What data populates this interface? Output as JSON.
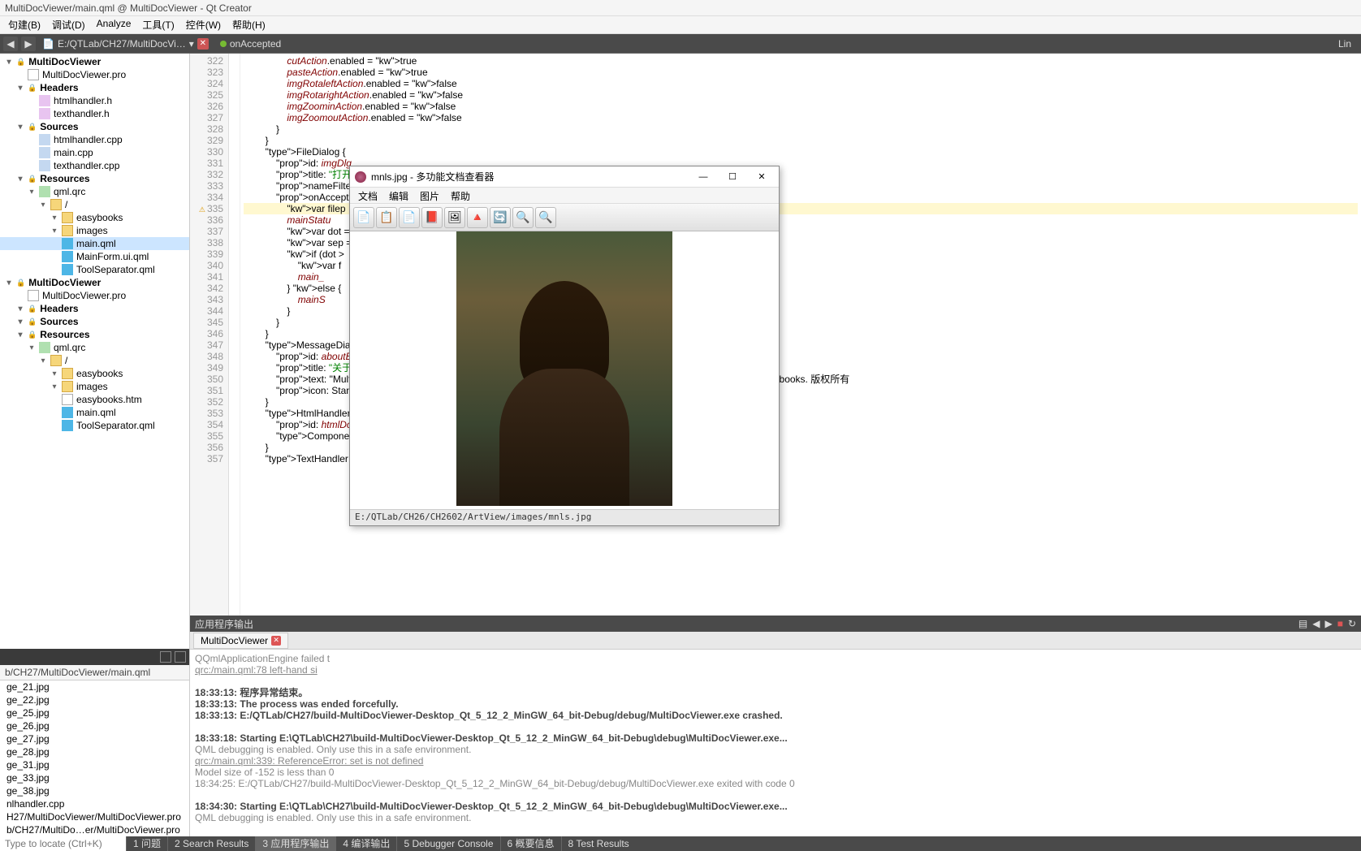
{
  "window": {
    "title": "MultiDocViewer/main.qml @ MultiDocViewer - Qt Creator"
  },
  "menu": {
    "items": [
      "句建(B)",
      "调试(D)",
      "Analyze",
      "工具(T)",
      "控件(W)",
      "帮助(H)"
    ]
  },
  "toolbar": {
    "path": "E:/QTLab/CH27/MultiDocVi…",
    "crumb": "onAccepted",
    "right": "Lin"
  },
  "project_tree": {
    "root": "MultiDocViewer",
    "items": [
      {
        "l": 0,
        "t": "hdr",
        "label": "MultiDocViewer"
      },
      {
        "l": 1,
        "t": "proj",
        "label": "MultiDocViewer.pro"
      },
      {
        "l": 1,
        "t": "hdr",
        "label": "Headers"
      },
      {
        "l": 2,
        "t": "h",
        "label": "htmlhandler.h"
      },
      {
        "l": 2,
        "t": "h",
        "label": "texthandler.h"
      },
      {
        "l": 1,
        "t": "hdr",
        "label": "Sources"
      },
      {
        "l": 2,
        "t": "cpp",
        "label": "htmlhandler.cpp"
      },
      {
        "l": 2,
        "t": "cpp",
        "label": "main.cpp"
      },
      {
        "l": 2,
        "t": "cpp",
        "label": "texthandler.cpp"
      },
      {
        "l": 1,
        "t": "hdr",
        "label": "Resources"
      },
      {
        "l": 2,
        "t": "qrc",
        "label": "qml.qrc"
      },
      {
        "l": 3,
        "t": "fold",
        "label": "/"
      },
      {
        "l": 4,
        "t": "fold",
        "label": "easybooks"
      },
      {
        "l": 4,
        "t": "fold",
        "label": "images"
      },
      {
        "l": 4,
        "t": "qml",
        "label": "main.qml",
        "sel": true
      },
      {
        "l": 4,
        "t": "qml",
        "label": "MainForm.ui.qml"
      },
      {
        "l": 4,
        "t": "qml",
        "label": "ToolSeparator.qml"
      },
      {
        "l": 0,
        "t": "hdr",
        "label": "MultiDocViewer"
      },
      {
        "l": 1,
        "t": "proj",
        "label": "MultiDocViewer.pro"
      },
      {
        "l": 1,
        "t": "hdr",
        "label": "Headers"
      },
      {
        "l": 1,
        "t": "hdr",
        "label": "Sources"
      },
      {
        "l": 1,
        "t": "hdr",
        "label": "Resources"
      },
      {
        "l": 2,
        "t": "qrc",
        "label": "qml.qrc"
      },
      {
        "l": 3,
        "t": "fold",
        "label": "/"
      },
      {
        "l": 4,
        "t": "fold",
        "label": "easybooks"
      },
      {
        "l": 4,
        "t": "fold",
        "label": "images"
      },
      {
        "l": 4,
        "t": "file",
        "label": "easybooks.htm"
      },
      {
        "l": 4,
        "t": "qml",
        "label": "main.qml"
      },
      {
        "l": 4,
        "t": "qml",
        "label": "ToolSeparator.qml"
      }
    ]
  },
  "open_doc": {
    "current": "b/CH27/MultiDocViewer/main.qml",
    "list": [
      "ge_21.jpg",
      "ge_22.jpg",
      "ge_25.jpg",
      "ge_26.jpg",
      "ge_27.jpg",
      "ge_28.jpg",
      "ge_31.jpg",
      "ge_33.jpg",
      "ge_38.jpg",
      "nlhandler.cpp",
      "H27/MultiDocViewer/MultiDocViewer.pro",
      "b/CH27/MultiDo…er/MultiDocViewer.pro"
    ]
  },
  "locate_placeholder": "Type to locate (Ctrl+K)",
  "code": {
    "first_line": 322,
    "lines": [
      "                cutAction.enabled = true",
      "                pasteAction.enabled = true",
      "                imgRotaleftAction.enabled = false",
      "                imgRotarightAction.enabled = false",
      "                imgZoominAction.enabled = false",
      "                imgZoomoutAction.enabled = false",
      "            }",
      "        }",
      "        FileDialog {",
      "            id: imgDlg",
      "            title: \"打开图\"",
      "            nameFilters:",
      "            onAccepted: {",
      "                var filep",
      "                mainStatu",
      "                var dot =",
      "                var sep =",
      "                if (dot >",
      "                    var f",
      "                    main_",
      "                } else {",
      "                    mainS",
      "                }",
      "            }",
      "        }",
      "        MessageDialog {",
      "            id: aboutBox",
      "            title: \"关于\"",
      "            text: \"MultiD                                                                 ick Controls 开发而成。 \\nCopyright © 2010 - 2017 easybooks. 版权所有",
      "            icon: Standar",
      "        }",
      "        HtmlHandler {",
      "            id: htmlDoc",
      "            Component.onC",
      "        }",
      "        TextHandler {"
    ],
    "hl_suffix": "or."
  },
  "output": {
    "header": "应用程序输出",
    "tab": "MultiDocViewer",
    "lines": [
      {
        "t": "",
        "v": "QQmlApplicationEngine failed t"
      },
      {
        "t": "link",
        "v": "qrc:/main.qml:78 left-hand si"
      },
      {
        "t": "",
        "v": ""
      },
      {
        "t": "bold",
        "v": "18:33:13: 程序异常结束。"
      },
      {
        "t": "bold",
        "v": "18:33:13: The process was ended forcefully."
      },
      {
        "t": "bold",
        "v": "18:33:13: E:/QTLab/CH27/build-MultiDocViewer-Desktop_Qt_5_12_2_MinGW_64_bit-Debug/debug/MultiDocViewer.exe crashed."
      },
      {
        "t": "",
        "v": ""
      },
      {
        "t": "bold",
        "v": "18:33:18: Starting E:\\QTLab\\CH27\\build-MultiDocViewer-Desktop_Qt_5_12_2_MinGW_64_bit-Debug\\debug\\MultiDocViewer.exe..."
      },
      {
        "t": "",
        "v": "QML debugging is enabled. Only use this in a safe environment."
      },
      {
        "t": "link",
        "v": "qrc:/main.qml:339: ReferenceError: set is not defined"
      },
      {
        "t": "",
        "v": "Model size of -152 is less than 0"
      },
      {
        "t": "",
        "v": "18:34:25: E:/QTLab/CH27/build-MultiDocViewer-Desktop_Qt_5_12_2_MinGW_64_bit-Debug/debug/MultiDocViewer.exe exited with code 0"
      },
      {
        "t": "",
        "v": ""
      },
      {
        "t": "bold",
        "v": "18:34:30: Starting E:\\QTLab\\CH27\\build-MultiDocViewer-Desktop_Qt_5_12_2_MinGW_64_bit-Debug\\debug\\MultiDocViewer.exe..."
      },
      {
        "t": "",
        "v": "QML debugging is enabled. Only use this in a safe environment."
      }
    ]
  },
  "statusbar": {
    "items": [
      "1 问题",
      "2 Search Results",
      "3 应用程序输出",
      "4 编译输出",
      "5 Debugger Console",
      "6 概要信息",
      "8 Test Results"
    ],
    "active_idx": 2
  },
  "viewer": {
    "title": "mnls.jpg - 多功能文档查看器",
    "menu": [
      "文档",
      "编辑",
      "图片",
      "帮助"
    ],
    "status": "E:/QTLab/CH26/CH2602/ArtView/images/mnls.jpg",
    "tool_icons": [
      "📄",
      "📋",
      "📄",
      "📕",
      "🖼",
      "🔺",
      "🔄",
      "🔍",
      "🔍"
    ]
  }
}
